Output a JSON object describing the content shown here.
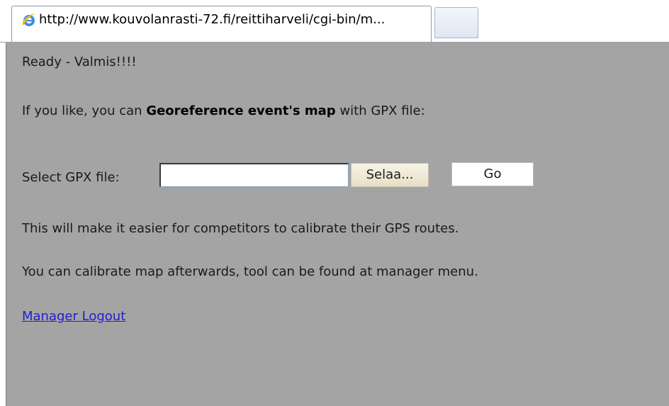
{
  "browser": {
    "tab_title": "http://www.kouvolanrasti-72.fi/reittiharveli/cgi-bin/m...",
    "tab_icon": "internet-explorer-icon"
  },
  "page": {
    "status_text": "Ready - Valmis!!!!",
    "intro_prefix": "If you like, you can ",
    "intro_bold": "Georeference event's map",
    "intro_suffix": " with GPX file:",
    "file_label": "Select GPX file:",
    "file_value": "",
    "browse_label": "Selaa...",
    "go_label": "Go",
    "info_line_1": "This will make it easier for competitors to calibrate their GPS routes.",
    "info_line_2": "You can calibrate map afterwards, tool can be found at manager menu.",
    "logout_link": "Manager Logout"
  },
  "colors": {
    "page_background": "#a4a4a4",
    "link": "#1f1fcf"
  }
}
